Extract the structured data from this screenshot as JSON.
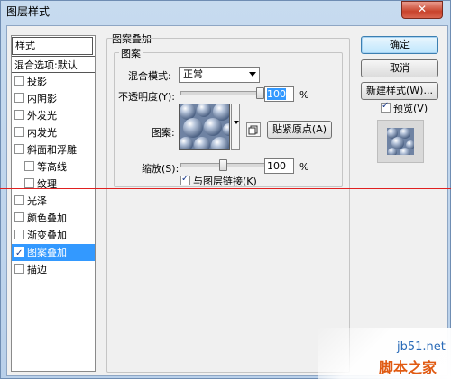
{
  "window": {
    "title": "图层样式",
    "close": "✕"
  },
  "styles_list": {
    "header": "样式",
    "items": [
      {
        "label": "混合选项:默认",
        "checkbox": false,
        "checked": false,
        "selected": false,
        "sub": false
      },
      {
        "label": "投影",
        "checkbox": true,
        "checked": false,
        "selected": false,
        "sub": false
      },
      {
        "label": "内阴影",
        "checkbox": true,
        "checked": false,
        "selected": false,
        "sub": false
      },
      {
        "label": "外发光",
        "checkbox": true,
        "checked": false,
        "selected": false,
        "sub": false
      },
      {
        "label": "内发光",
        "checkbox": true,
        "checked": false,
        "selected": false,
        "sub": false
      },
      {
        "label": "斜面和浮雕",
        "checkbox": true,
        "checked": false,
        "selected": false,
        "sub": false
      },
      {
        "label": "等高线",
        "checkbox": true,
        "checked": false,
        "selected": false,
        "sub": true
      },
      {
        "label": "纹理",
        "checkbox": true,
        "checked": false,
        "selected": false,
        "sub": true
      },
      {
        "label": "光泽",
        "checkbox": true,
        "checked": false,
        "selected": false,
        "sub": false
      },
      {
        "label": "颜色叠加",
        "checkbox": true,
        "checked": false,
        "selected": false,
        "sub": false
      },
      {
        "label": "渐变叠加",
        "checkbox": true,
        "checked": false,
        "selected": false,
        "sub": false
      },
      {
        "label": "图案叠加",
        "checkbox": true,
        "checked": true,
        "selected": true,
        "sub": false
      },
      {
        "label": "描边",
        "checkbox": true,
        "checked": false,
        "selected": false,
        "sub": false
      }
    ]
  },
  "pattern_overlay": {
    "section_title": "图案叠加",
    "group_title": "图案",
    "blend_mode_label": "混合模式:",
    "blend_mode_value": "正常",
    "opacity_label": "不透明度(Y):",
    "opacity_value": "100",
    "opacity_level": 100,
    "percent": "%",
    "pattern_label": "图案:",
    "snap_origin_button": "贴紧原点(A)",
    "scale_label": "缩放(S):",
    "scale_value": "100",
    "scale_level": 50,
    "link_layer_label": "与图层链接(K)",
    "link_layer_checked": true
  },
  "actions": {
    "ok": "确定",
    "cancel": "取消",
    "new_style": "新建样式(W)...",
    "preview_label": "预览(V)",
    "preview_checked": true
  },
  "watermark": {
    "site": "jb51.net",
    "name": "脚本之家"
  },
  "colors": {
    "selection": "#3399ff",
    "red_guide": "#e02020",
    "pattern_blue": "#7d8faa"
  }
}
